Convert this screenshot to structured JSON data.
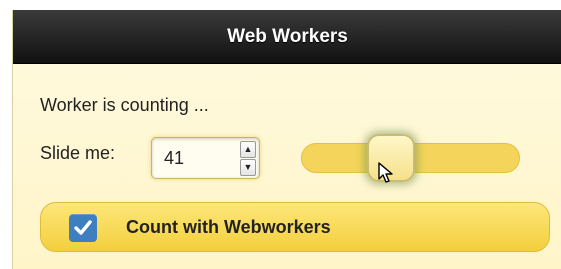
{
  "header": {
    "title": "Web Workers"
  },
  "main": {
    "status_text": "Worker is counting ...",
    "slider_label": "Slide me:",
    "stepper": {
      "value": "41"
    },
    "slider": {
      "value_fraction": 0.4
    },
    "checkbox": {
      "label": "Count with Webworkers",
      "checked": true
    }
  },
  "colors": {
    "header_bg": "#111111",
    "content_bg": "#fff8d6",
    "accent_yellow": "#f4d45a",
    "checkbox_blue": "#3e7fc0"
  },
  "icons": {
    "spin_up": "triangle-up-icon",
    "spin_down": "triangle-down-icon",
    "check": "checkmark-icon",
    "cursor": "mouse-pointer-icon"
  }
}
